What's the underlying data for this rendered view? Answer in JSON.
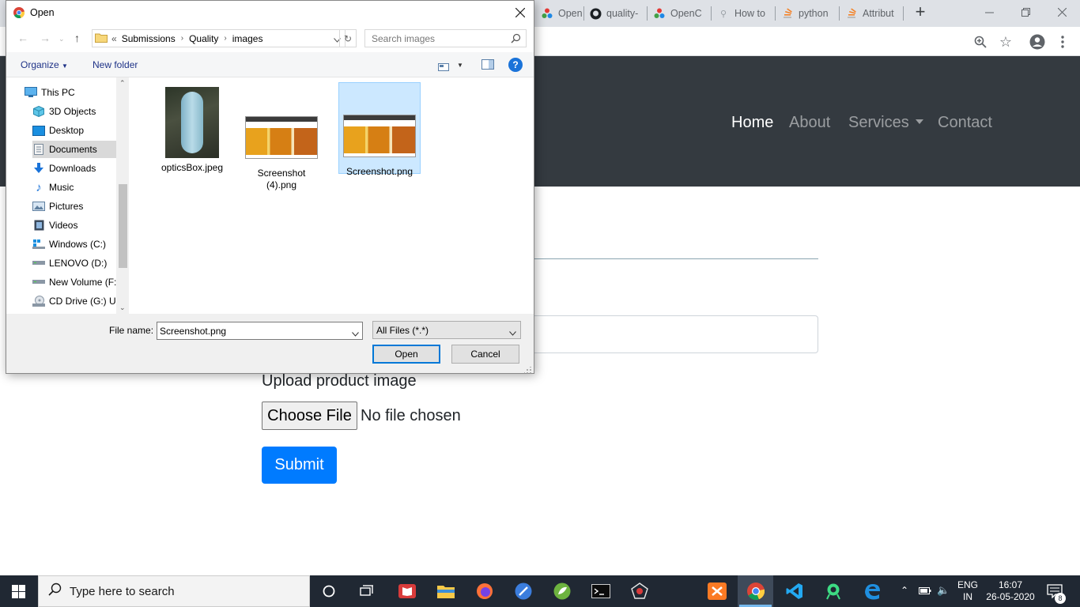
{
  "browser": {
    "tabs": [
      {
        "label": "OpenC"
      },
      {
        "label": "quality-"
      },
      {
        "label": "OpenC"
      },
      {
        "label": "How to"
      },
      {
        "label": "python"
      },
      {
        "label": "Attribut"
      }
    ],
    "new_tab_glyph": "+",
    "icons": [
      "zoom-icon",
      "star-icon",
      "account-icon",
      "menu-icon"
    ]
  },
  "page": {
    "nav": {
      "items": [
        {
          "label": "Home",
          "active": true
        },
        {
          "label": "About",
          "active": false
        },
        {
          "label": "Services",
          "active": false,
          "dropdown": true
        },
        {
          "label": "Contact",
          "active": false
        }
      ]
    },
    "upload_label": "Upload product image",
    "choose_file_label": "Choose File",
    "no_file_text": "No file chosen",
    "submit_label": "Submit",
    "colors": {
      "navbar": "#343a40",
      "primary": "#007bff"
    }
  },
  "dialog": {
    "title": "Open",
    "breadcrumb": {
      "prefix": "«",
      "parts": [
        "Submissions",
        "Quality",
        "images"
      ]
    },
    "search_placeholder": "Search images",
    "commands": {
      "organize": "Organize",
      "new_folder": "New folder"
    },
    "nav_items": [
      {
        "label": "This PC",
        "icon": "computer-icon"
      },
      {
        "label": "3D Objects",
        "icon": "cube-icon"
      },
      {
        "label": "Desktop",
        "icon": "desktop-icon"
      },
      {
        "label": "Documents",
        "icon": "document-icon",
        "selected": true
      },
      {
        "label": "Downloads",
        "icon": "download-arrow-icon"
      },
      {
        "label": "Music",
        "icon": "music-note-icon"
      },
      {
        "label": "Pictures",
        "icon": "picture-icon"
      },
      {
        "label": "Videos",
        "icon": "film-icon"
      },
      {
        "label": "Windows (C:)",
        "icon": "windows-drive-icon"
      },
      {
        "label": "LENOVO (D:)",
        "icon": "drive-icon"
      },
      {
        "label": "New Volume (F:)",
        "icon": "drive-icon"
      },
      {
        "label": "CD Drive (G:) Ub",
        "icon": "cd-drive-icon"
      }
    ],
    "files": [
      {
        "name": "opticsBox.jpeg",
        "name_line2": "",
        "kind": "photo",
        "selected": false
      },
      {
        "name": "Screenshot",
        "name_line2": "(4).png",
        "kind": "screenshot",
        "selected": false
      },
      {
        "name": "Screenshot.png",
        "name_line2": "",
        "kind": "screenshot",
        "selected": true
      }
    ],
    "file_name_label": "File name:",
    "file_name_value": "Screenshot.png",
    "file_type": "All Files (*.*)",
    "open_label": "Open",
    "cancel_label": "Cancel",
    "help_glyph": "?"
  },
  "taskbar": {
    "search_placeholder": "Type here to search",
    "tray": {
      "lang_line1": "ENG",
      "lang_line2": "IN",
      "time": "16:07",
      "date": "26-05-2020",
      "notifications": "8"
    }
  }
}
